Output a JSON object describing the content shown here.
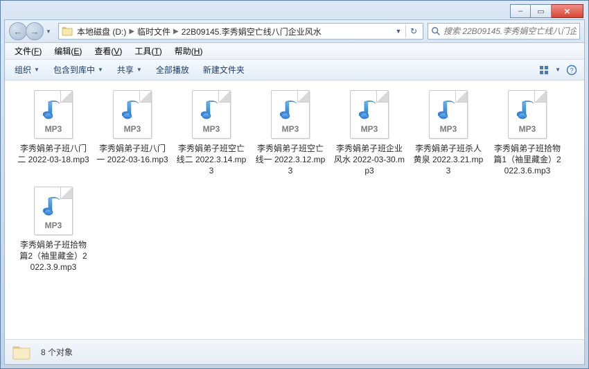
{
  "sysbuttons": {
    "min": "–",
    "max": "▭",
    "close": "×"
  },
  "nav": {
    "back": "←",
    "fwd": "→",
    "drop": "▼",
    "refresh": "↻"
  },
  "address": {
    "crumbs": [
      "本地磁盘 (D:)",
      "临时文件",
      "22B09145.李秀娟空亡线八门企业风水"
    ],
    "sep": "▶"
  },
  "search": {
    "placeholder": "搜索 22B09145.李秀娟空亡线八门企..."
  },
  "menu": {
    "file": {
      "label": "文件",
      "key": "F"
    },
    "edit": {
      "label": "编辑",
      "key": "E"
    },
    "view": {
      "label": "查看",
      "key": "V"
    },
    "tools": {
      "label": "工具",
      "key": "T"
    },
    "help": {
      "label": "帮助",
      "key": "H"
    }
  },
  "cmd": {
    "organize": "组织",
    "library": "包含到库中",
    "share": "共享",
    "playall": "全部播放",
    "newfolder": "新建文件夹",
    "drop": "▼"
  },
  "filetype_label": "MP3",
  "files": [
    {
      "name": "李秀娟弟子班八门二 2022-03-18.mp3"
    },
    {
      "name": "李秀娟弟子班八门一 2022-03-16.mp3"
    },
    {
      "name": "李秀娟弟子班空亡线二 2022.3.14.mp3"
    },
    {
      "name": "李秀娟弟子班空亡线一 2022.3.12.mp3"
    },
    {
      "name": "李秀娟弟子班企业风水 2022-03-30.mp3"
    },
    {
      "name": "李秀娟弟子班杀人黄泉 2022.3.21.mp3"
    },
    {
      "name": "李秀娟弟子班拾物篇1（袖里藏金）2022.3.6.mp3"
    },
    {
      "name": "李秀娟弟子班拾物篇2（袖里藏金）2022.3.9.mp3"
    }
  ],
  "status": {
    "count_label": "8 个对象"
  }
}
